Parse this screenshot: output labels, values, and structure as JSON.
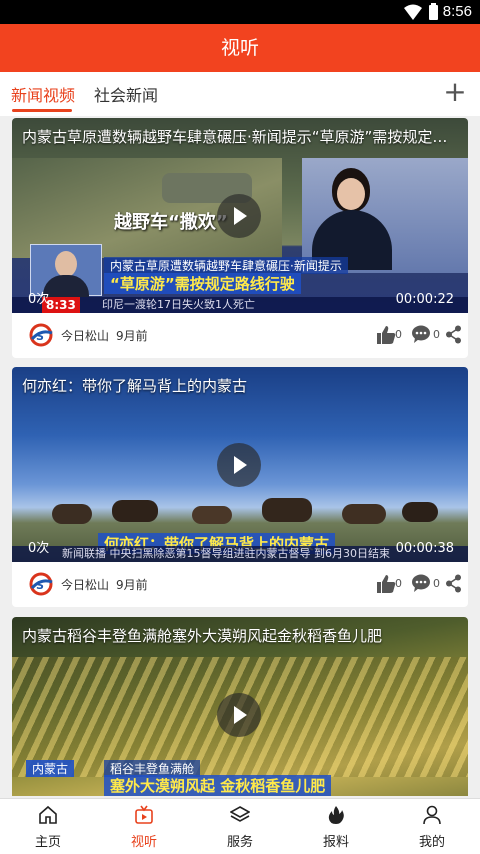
{
  "status_bar": {
    "time": "8:56"
  },
  "app_bar": {
    "title": "视听"
  },
  "tabs": [
    {
      "label": "新闻视频",
      "active": true
    },
    {
      "label": "社会新闻",
      "active": false
    }
  ],
  "add_tab_icon": "plus-icon",
  "feed": [
    {
      "title": "内蒙古草原遭数辆越野车肆意碾压·新闻提示“草原游”需按规定路线行驶",
      "overlay_label": "越野车“撒欢”",
      "caption_top": "内蒙古草原遭数辆越野车肆意碾压·新闻提示",
      "caption_main": "“草原游”需按规定路线行驶",
      "ticker_time": "8:33",
      "ticker": "印尼一渡轮17日失火致1人死亡",
      "views": "0次",
      "duration": "00:00:22",
      "source": "今日松山",
      "age": "9月前",
      "likes": "0",
      "comments": "0"
    },
    {
      "title": "何亦红：带你了解马背上的内蒙古",
      "caption_main": "何亦红：带你了解马背上的内蒙古",
      "ticker": "新闻联播  中央扫黑除恶第15督导组进驻内蒙古督导 到6月30日结束",
      "views": "0次",
      "duration": "00:00:38",
      "source": "今日松山",
      "age": "9月前",
      "likes": "0",
      "comments": "0"
    },
    {
      "title": "内蒙古稻谷丰登鱼满舱塞外大漠朔风起金秋稻香鱼儿肥",
      "caption_top_label": "内蒙古",
      "caption_top": "稻谷丰登鱼满舱",
      "caption_main": "塞外大漠朔风起 金秋稻香鱼儿肥"
    }
  ],
  "bottom_nav": [
    {
      "label": "主页",
      "icon": "home-icon",
      "active": false
    },
    {
      "label": "视听",
      "icon": "tv-icon",
      "active": true
    },
    {
      "label": "服务",
      "icon": "layers-icon",
      "active": false
    },
    {
      "label": "报料",
      "icon": "flame-icon",
      "active": false
    },
    {
      "label": "我的",
      "icon": "person-icon",
      "active": false
    }
  ],
  "colors": {
    "brand": "#f2431f",
    "active_tab": "#e8421d"
  }
}
